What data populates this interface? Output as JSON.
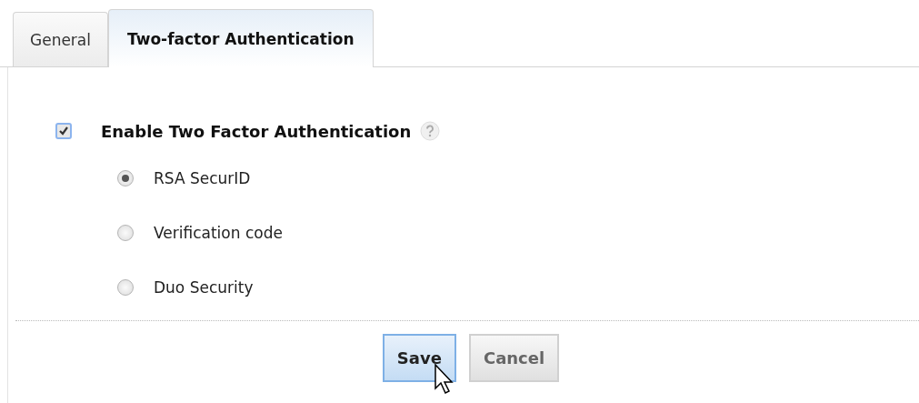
{
  "tabs": [
    {
      "label": "General",
      "selected": false
    },
    {
      "label": "Two-factor Authentication",
      "selected": true
    }
  ],
  "enable": {
    "label": "Enable Two Factor Authentication",
    "checked": true
  },
  "methods": [
    {
      "label": "RSA SecurID",
      "selected": true
    },
    {
      "label": "Verification code",
      "selected": false
    },
    {
      "label": "Duo Security",
      "selected": false
    }
  ],
  "buttons": [
    {
      "label": "Save",
      "hovered": true
    },
    {
      "label": "Cancel",
      "hovered": false
    }
  ]
}
